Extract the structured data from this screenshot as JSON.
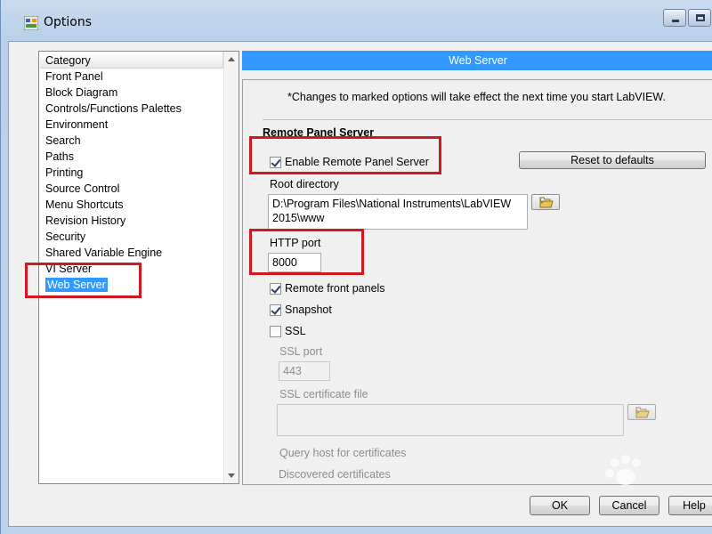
{
  "window": {
    "title": "Options"
  },
  "category": {
    "header": "Category",
    "items": [
      "Front Panel",
      "Block Diagram",
      "Controls/Functions Palettes",
      "Environment",
      "Search",
      "Paths",
      "Printing",
      "Source Control",
      "Menu Shortcuts",
      "Revision History",
      "Security",
      "Shared Variable Engine",
      "VI Server",
      "Web Server"
    ],
    "selected": "Web Server"
  },
  "panel": {
    "banner": "Web Server",
    "notice": "*Changes to marked options will take effect the next time you start LabVIEW.",
    "group_title": "Remote Panel Server",
    "enable_remote_panel_server": {
      "label": "Enable Remote Panel Server",
      "checked": true
    },
    "reset_button": "Reset to defaults",
    "root_directory": {
      "label": "Root directory",
      "line1": "D:\\Program Files\\National Instruments\\LabVIEW",
      "line2": "2015\\www"
    },
    "http_port": {
      "label": "HTTP port",
      "value": "8000"
    },
    "remote_front_panels": {
      "label": "Remote front panels",
      "checked": true
    },
    "snapshot": {
      "label": "Snapshot",
      "checked": true
    },
    "ssl": {
      "label": "SSL",
      "checked": false
    },
    "ssl_port": {
      "label": "SSL port",
      "value": "443"
    },
    "ssl_certificate_file": {
      "label": "SSL certificate file",
      "value": ""
    },
    "query_host": "Query host for certificates",
    "discovered_certificates": "Discovered certificates"
  },
  "buttons": {
    "ok": "OK",
    "cancel": "Cancel",
    "help": "Help"
  },
  "colors": {
    "selection": "#3399ff",
    "highlight": "#d0181e"
  },
  "icons": [
    "labview-options-icon",
    "minimize-icon",
    "maximize-icon",
    "folder-icon",
    "check-icon"
  ]
}
